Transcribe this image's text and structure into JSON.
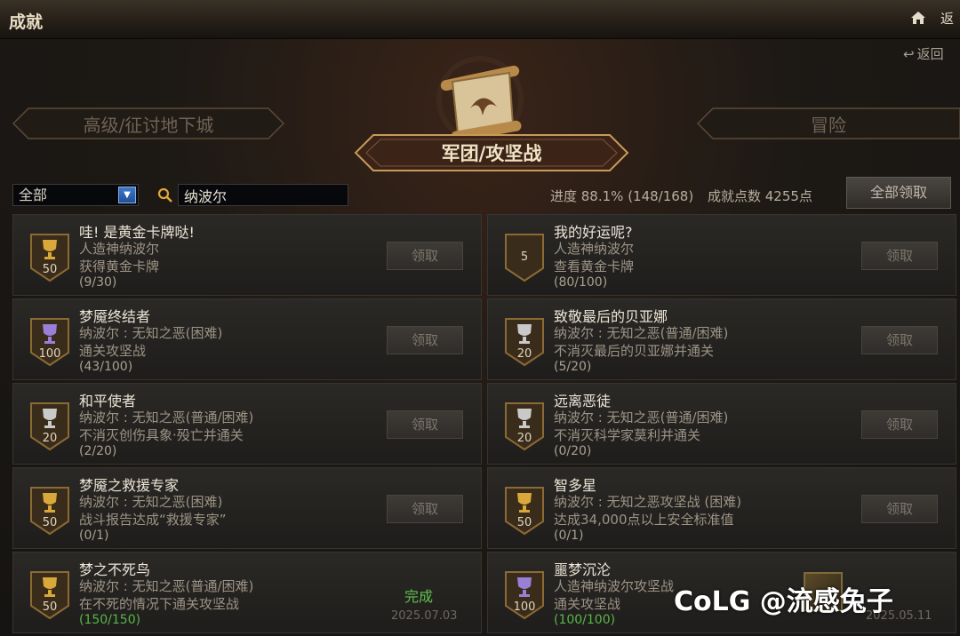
{
  "window": {
    "title": "成就",
    "top_return": "返"
  },
  "return_label": "返回",
  "tabs": {
    "left": "高级/征讨地下城",
    "center": "军团/攻坚战",
    "right": "冒险"
  },
  "filter": {
    "selected": "全部",
    "search_value": "纳波尔"
  },
  "stats": {
    "progress": "进度  88.1% (148/168)",
    "points": "成就点数  4255点"
  },
  "claim_all_label": "全部领取",
  "achievements": [
    {
      "name": "哇! 是黄金卡牌哒!",
      "l1": "人造神纳波尔",
      "l2": "获得黄金卡牌",
      "count": "(9/30)",
      "points": "50",
      "tier": "gold",
      "state": "claim",
      "claim_label": "领取"
    },
    {
      "name": "我的好运呢?",
      "l1": "人造神纳波尔",
      "l2": "查看黄金卡牌",
      "count": "(80/100)",
      "points": "5",
      "tier": "none",
      "state": "claim",
      "claim_label": "领取"
    },
    {
      "name": "梦魇终结者",
      "l1": "纳波尔 : 无知之恶(困难)",
      "l2": "通关攻坚战",
      "count": "(43/100)",
      "points": "100",
      "tier": "purple",
      "state": "claim",
      "claim_label": "领取"
    },
    {
      "name": "致敬最后的贝亚娜",
      "l1": "纳波尔 : 无知之恶(普通/困难)",
      "l2": "不消灭最后的贝亚娜并通关",
      "count": "(5/20)",
      "points": "20",
      "tier": "silver",
      "state": "claim",
      "claim_label": "领取"
    },
    {
      "name": "和平使者",
      "l1": "纳波尔 : 无知之恶(普通/困难)",
      "l2": "不消灭创伤具象·殁亡并通关",
      "count": "(2/20)",
      "points": "20",
      "tier": "silver",
      "state": "claim",
      "claim_label": "领取"
    },
    {
      "name": "远离恶徒",
      "l1": "纳波尔 : 无知之恶(普通/困难)",
      "l2": "不消灭科学家莫利并通关",
      "count": "(0/20)",
      "points": "20",
      "tier": "silver",
      "state": "claim",
      "claim_label": "领取"
    },
    {
      "name": "梦魇之救援专家",
      "l1": "纳波尔 : 无知之恶(困难)",
      "l2": "战斗报告达成“救援专家”",
      "count": "(0/1)",
      "points": "50",
      "tier": "gold",
      "state": "claim",
      "claim_label": "领取"
    },
    {
      "name": "智多星",
      "l1": "纳波尔 : 无知之恶攻坚战 (困难)",
      "l2": "达成34,000点以上安全标准值",
      "count": "(0/1)",
      "points": "50",
      "tier": "gold",
      "state": "claim",
      "claim_label": "领取"
    },
    {
      "name": "梦之不死鸟",
      "l1": "纳波尔 : 无知之恶(普通/困难)",
      "l2": "在不死的情况下通关攻坚战",
      "count": "(150/150)",
      "points": "50",
      "tier": "gold",
      "state": "done",
      "complete_label": "完成",
      "date": "2025.07.03"
    },
    {
      "name": "噩梦沉沦",
      "l1": "人造神纳波尔攻坚战",
      "l2": "通关攻坚战",
      "count": "(100/100)",
      "points": "100",
      "tier": "purple",
      "state": "done",
      "complete_label": "",
      "date": "2025.05.11"
    }
  ],
  "watermark": "CoLG @流感兔子",
  "colors": {
    "gold": "#d8a93a",
    "silver": "#c9c9c9",
    "purple": "#9a7fd6",
    "complete_green": "#5fc04e"
  }
}
